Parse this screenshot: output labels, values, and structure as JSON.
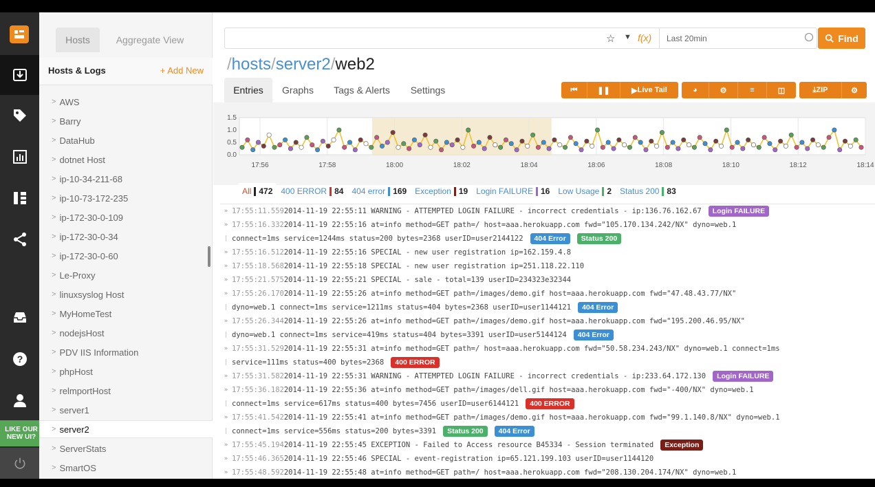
{
  "colors": {
    "accent": "#ee8a1e",
    "rail": "#2b2b2b",
    "link": "#4a8fd1",
    "tag_404_error": "#3d8fd3",
    "tag_status_200": "#4caf6a",
    "tag_login_failure": "#a066c8",
    "tag_400_error": "#d9302a",
    "tag_exception": "#7a1f18"
  },
  "rail": {
    "icons": [
      "logo-icon",
      "inbox-download-icon",
      "tag-icon",
      "bar-chart-icon",
      "hierarchy-icon",
      "share-icon",
      "inbox-tray-icon",
      "help-icon",
      "user-icon",
      "power-icon"
    ],
    "promo": "LIKE OUR NEW UI?"
  },
  "sidebar": {
    "tabs": [
      "Hosts",
      "Aggregate View"
    ],
    "title": "Hosts & Logs",
    "add_new": "+ Add New",
    "hosts": [
      "AWS",
      "Barry",
      "DataHub",
      "dotnet Host",
      "ip-10-34-211-68",
      "ip-10-73-172-235",
      "ip-172-30-0-109",
      "ip-172-30-0-34",
      "ip-172-30-0-60",
      "Le-Proxy",
      "linuxsyslog Host",
      "MyHomeTest",
      "nodejsHost",
      "PDV IIS Information",
      "phpHost",
      "relmportHost",
      "server1",
      "server2",
      "ServerStats",
      "SmartOS"
    ],
    "selected_host": "server2"
  },
  "search": {
    "query": "",
    "time_range": "Last 20min",
    "find_label": "Find",
    "fx": "f(x)"
  },
  "breadcrumb": {
    "parts": [
      "hosts",
      "server2",
      "web2"
    ],
    "sep": "/"
  },
  "tabs": [
    "Entries",
    "Graphs",
    "Tags & Alerts",
    "Settings"
  ],
  "toolbar": {
    "live_tail": "Live Tail",
    "zip": "ZIP"
  },
  "chart_data": {
    "type": "line",
    "title": "",
    "xlabel": "",
    "ylabel": "",
    "ylim": [
      0,
      1.5
    ],
    "y_ticks": [
      "0.0",
      "0.5",
      "1.0",
      "1.5"
    ],
    "x_ticks": [
      "17:56",
      "17:58",
      "18:00",
      "18:02",
      "18:04",
      "18:06",
      "18:08",
      "18:10",
      "18:12",
      "18:14"
    ],
    "grid": true,
    "highlight_range": [
      "17:59:20",
      "18:04:40"
    ],
    "series": [
      {
        "color": "#f2c230",
        "values": [
          0.3,
          0.6,
          0.2,
          0.5,
          0.35,
          0.8,
          0.3,
          0.4,
          0.6,
          0.25,
          0.5,
          0.3,
          0.7,
          0.4,
          0.2,
          0.55,
          0.35,
          0.6,
          1.0,
          0.3,
          0.5,
          0.2,
          0.6,
          0.45,
          0.3,
          0.7,
          0.35,
          0.5,
          0.9,
          0.3,
          0.45,
          0.25,
          0.6,
          0.4,
          0.8,
          0.3,
          0.55,
          0.2,
          0.5,
          0.4,
          0.6,
          0.3,
          1.0,
          0.35,
          0.5,
          0.25,
          0.7,
          0.4,
          0.3,
          0.6,
          0.45,
          0.2,
          0.55,
          0.35,
          0.8,
          0.3,
          0.5,
          0.25,
          0.6,
          0.4,
          0.3,
          0.7,
          0.45,
          0.2,
          0.55,
          0.35,
          1.0,
          0.3,
          0.5,
          0.25,
          0.6,
          0.4,
          0.3,
          0.7,
          0.5,
          0.2,
          0.55,
          0.35,
          0.9,
          0.3,
          0.5,
          0.25,
          0.6,
          0.4,
          0.3,
          0.7,
          0.45,
          0.2,
          0.55,
          0.35,
          1.0,
          0.3,
          0.5,
          0.25,
          0.6,
          0.4,
          0.3,
          0.7,
          0.45,
          0.2,
          0.55,
          0.35,
          0.8,
          0.3,
          0.5,
          0.25,
          0.6,
          0.4,
          0.3,
          0.7,
          1.0,
          0.2,
          0.55,
          0.35,
          0.6,
          0.3
        ]
      }
    ]
  },
  "filters": [
    {
      "label": "All",
      "count": "472",
      "color": "#222222"
    },
    {
      "label": "400 ERROR",
      "count": "84",
      "color": "#d9302a"
    },
    {
      "label": "404 error",
      "count": "169",
      "color": "#3d8fd3"
    },
    {
      "label": "Exception",
      "count": "19",
      "color": "#7a1f18"
    },
    {
      "label": "Login FAILURE",
      "count": "16",
      "color": "#a066c8"
    },
    {
      "label": "Low Usage",
      "count": "2",
      "color": "#4caf6a"
    },
    {
      "label": "Status 200",
      "count": "83",
      "color": "#4caf6a"
    }
  ],
  "logs": [
    {
      "ts": "17:55:11.559",
      "text": "2014-11-19 22:55:11 WARNING - ATTEMPTED LOGIN FAILURE - incorrect credentials - ip:136.76.162.67",
      "tags": [
        {
          "label": "Login FAILURE",
          "color": "#a066c8"
        }
      ]
    },
    {
      "ts": "17:55:16.332",
      "text": "2014-11-19 22:55:16 at=info method=GET path=/ host=aaa.herokuapp.com fwd=\"105.170.134.242/NX\" dyno=web.1",
      "tags": []
    },
    {
      "cont": true,
      "text": "connect=1ms service=1244ms status=200 bytes=2368 userID=user2144122",
      "tags": [
        {
          "label": "404 Error",
          "color": "#3d8fd3"
        },
        {
          "label": "Status 200",
          "color": "#4caf6a"
        }
      ]
    },
    {
      "ts": "17:55:16.512",
      "text": "2014-11-19 22:55:16 SPECIAL - new user registration ip=162.159.4.8",
      "tags": []
    },
    {
      "ts": "17:55:18.568",
      "text": "2014-11-19 22:55:18 SPECIAL - new user registration ip=251.118.22.110",
      "tags": []
    },
    {
      "ts": "17:55:21.575",
      "text": "2014-11-19 22:55:21 SPECIAL - sale - total=139 userID=234323e32344",
      "tags": []
    },
    {
      "ts": "17:55:26.170",
      "text": "2014-11-19 22:55:26 at=info method=GET path=/images/demo.gif host=aaa.herokuapp.com fwd=\"47.48.43.77/NX\"",
      "tags": []
    },
    {
      "cont": true,
      "text": "dyno=web.1 connect=1ms service=1211ms status=404 bytes=2368 userID=user1144121",
      "tags": [
        {
          "label": "404 Error",
          "color": "#3d8fd3"
        }
      ]
    },
    {
      "ts": "17:55:26.344",
      "text": "2014-11-19 22:55:26 at=info method=GET path=/images/demo.gif host=aaa.herokuapp.com fwd=\"195.200.46.95/NX\"",
      "tags": []
    },
    {
      "cont": true,
      "text": "dyno=web.1 connect=1ms service=419ms status=404 bytes=3391 userID=user5144124",
      "tags": [
        {
          "label": "404 Error",
          "color": "#3d8fd3"
        }
      ]
    },
    {
      "ts": "17:55:31.529",
      "text": "2014-11-19 22:55:31 at=info method=GET path=/ host=aaa.herokuapp.com fwd=\"50.58.234.243/NX\" dyno=web.1 connect=1ms",
      "tags": []
    },
    {
      "cont": true,
      "text": "service=111ms status=400 bytes=2368",
      "tags": [
        {
          "label": "400 ERROR",
          "color": "#d9302a"
        }
      ]
    },
    {
      "ts": "17:55:31.582",
      "text": "2014-11-19 22:55:31 WARNING - ATTEMPTED LOGIN FAILURE - incorrect credentials - ip:233.64.172.130",
      "tags": [
        {
          "label": "Login FAILURE",
          "color": "#a066c8"
        }
      ]
    },
    {
      "ts": "17:55:36.182",
      "text": "2014-11-19 22:55:36 at=info method=GET path=/images/dell.gif host=aaa.herokuapp.com fwd=\"-400/NX\" dyno=web.1",
      "tags": []
    },
    {
      "cont": true,
      "text": "connect=1ms service=617ms status=400 bytes=7456 userID=user6144121",
      "tags": [
        {
          "label": "400 ERROR",
          "color": "#d9302a"
        }
      ]
    },
    {
      "ts": "17:55:41.542",
      "text": "2014-11-19 22:55:41 at=info method=GET path=/images/demo.gif host=aaa.herokuapp.com fwd=\"99.1.140.8/NX\" dyno=web.1",
      "tags": []
    },
    {
      "cont": true,
      "text": "connect=1ms service=556ms status=200 bytes=3391",
      "tags": [
        {
          "label": "Status 200",
          "color": "#4caf6a"
        },
        {
          "label": "404 Error",
          "color": "#3d8fd3"
        }
      ]
    },
    {
      "ts": "17:55:45.194",
      "text": "2014-11-19 22:55:45 EXCEPTION - Failed to Access resource B45334 - Session terminated",
      "tags": [
        {
          "label": "Exception",
          "color": "#7a1f18"
        }
      ]
    },
    {
      "ts": "17:55:46.365",
      "text": "2014-11-19 22:55:46 SPECIAL - event-registration ip=65.121.199.103 userID=user1144120",
      "tags": []
    },
    {
      "ts": "17:55:48.592",
      "text": "2014-11-19 22:55:48 at=info method=GET path=/ host=aaa.herokuapp.com fwd=\"208.130.204.174/NX\" dyno=web.1",
      "tags": []
    }
  ]
}
